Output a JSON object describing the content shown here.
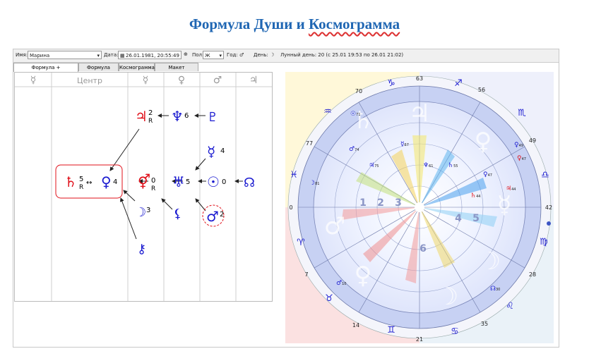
{
  "page": {
    "title_part1": "Формула Души и ",
    "title_part2": "Космограмма"
  },
  "toolbar": {
    "name_label": "Имя:",
    "name_value": "Марина",
    "date_label": "Дата:",
    "date_value": "26.01.1981, 20:55:49",
    "gender_label": "Пол:",
    "gender_value": "Ж",
    "year_label": "Год:",
    "day_label": "День:",
    "lunar_day": "Лунный день:  20 (с 25.01 19:53 по 26.01 21:02)"
  },
  "tabs": [
    "Формула + Космограмма",
    "Формула Души",
    "Космограмма",
    "Макет страницы"
  ],
  "formula": {
    "columns": [
      "☿",
      "Центр",
      "☿",
      "♀",
      "♂",
      "♃"
    ],
    "nodes": {
      "saturn": {
        "glyph": "♄",
        "num": "5",
        "r": "R"
      },
      "venus": {
        "glyph": "♀",
        "num": "4"
      },
      "jupiter": {
        "glyph": "♃",
        "num": "2",
        "r": "R"
      },
      "neptune": {
        "glyph": "♆",
        "num": "6"
      },
      "pluto": {
        "glyph": "♇"
      },
      "mercury": {
        "glyph": "☿",
        "num": "4"
      },
      "venus_mars": {
        "glyph": "⚥",
        "num": "0",
        "r": "R"
      },
      "uranus": {
        "glyph": "♅",
        "num": "5"
      },
      "sun": {
        "glyph": "☉",
        "num": "0"
      },
      "node": {
        "glyph": "☊"
      },
      "moon": {
        "glyph": "☽",
        "num": "3"
      },
      "lilith": {
        "glyph": "⚸"
      },
      "mars": {
        "glyph": "♂",
        "num": "2"
      },
      "chiron": {
        "glyph": "⚷"
      }
    }
  },
  "chart": {
    "degrees": {
      "top": "63",
      "bottom": "21",
      "left": "0",
      "right": "42",
      "upper_left": "70",
      "left_upper": "77",
      "lower_left": "7",
      "lower_right": "28",
      "upper_right": "49",
      "right_upper": "56",
      "lower_left2": "14",
      "lower_right2": "35"
    },
    "signs": [
      "♓",
      "♈",
      "♉",
      "♊",
      "♋",
      "♌",
      "♍",
      "♎",
      "♏",
      "♐",
      "♑",
      "♒"
    ],
    "planets": [
      {
        "glyph": "☉",
        "num": "71"
      },
      {
        "glyph": "♂",
        "num": "74"
      },
      {
        "glyph": "☿",
        "num": "67"
      },
      {
        "glyph": "♃",
        "num": "75"
      },
      {
        "glyph": "♆",
        "num": "61"
      },
      {
        "glyph": "♄",
        "num": "55"
      },
      {
        "glyph": "♀",
        "num": "47"
      },
      {
        "glyph": "♀",
        "num": "47"
      },
      {
        "glyph": "♄",
        "num": "44"
      },
      {
        "glyph": "♃",
        "num": "44"
      },
      {
        "glyph": "♀",
        "num": "49"
      },
      {
        "glyph": "☽",
        "num": "81"
      },
      {
        "glyph": "♂",
        "num": "10"
      },
      {
        "glyph": "☊",
        "num": "30"
      }
    ],
    "house_numbers": [
      "1",
      "2",
      "3",
      "4",
      "5",
      "6"
    ]
  },
  "colors": {
    "title": "#1f66b3",
    "red": "#e0101a",
    "blue": "#1a1ad0",
    "ring": "#b9c7ef"
  }
}
